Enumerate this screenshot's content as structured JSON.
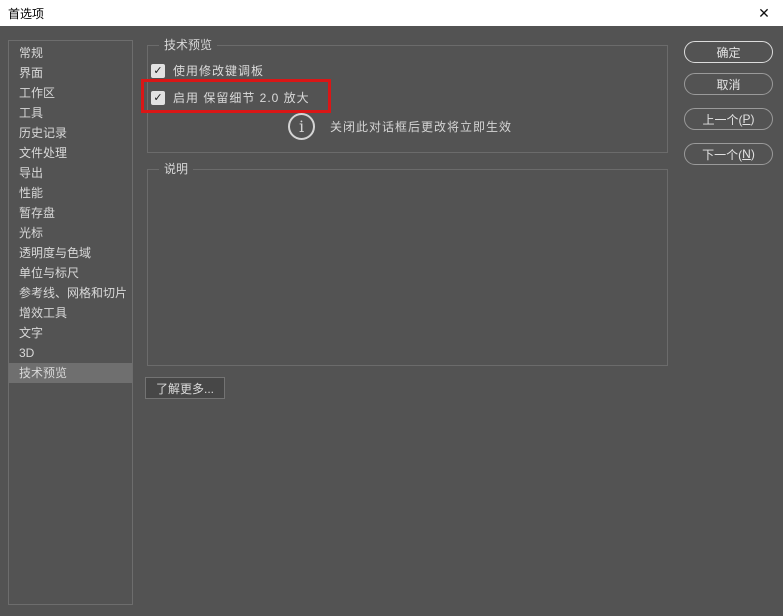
{
  "window": {
    "title": "首选项",
    "close_glyph": "✕"
  },
  "sidebar": {
    "items": [
      {
        "label": "常规",
        "selected": false
      },
      {
        "label": "界面",
        "selected": false
      },
      {
        "label": "工作区",
        "selected": false
      },
      {
        "label": "工具",
        "selected": false
      },
      {
        "label": "历史记录",
        "selected": false
      },
      {
        "label": "文件处理",
        "selected": false
      },
      {
        "label": "导出",
        "selected": false
      },
      {
        "label": "性能",
        "selected": false
      },
      {
        "label": "暂存盘",
        "selected": false
      },
      {
        "label": "光标",
        "selected": false
      },
      {
        "label": "透明度与色域",
        "selected": false
      },
      {
        "label": "单位与标尺",
        "selected": false
      },
      {
        "label": "参考线、网格和切片",
        "selected": false
      },
      {
        "label": "增效工具",
        "selected": false
      },
      {
        "label": "文字",
        "selected": false
      },
      {
        "label": "3D",
        "selected": false
      },
      {
        "label": "技术预览",
        "selected": true
      }
    ]
  },
  "content": {
    "tech_group": {
      "title": "技术预览",
      "check_glyph": "✓",
      "checkbox_modifier": {
        "label": "使用修改键调板",
        "checked": true
      },
      "checkbox_preserve": {
        "label": "启用 保留细节 2.0 放大",
        "checked": true,
        "annotated": true
      },
      "info_glyph": "i",
      "info_text": "关闭此对话框后更改将立即生效"
    },
    "desc_group": {
      "title": "说明",
      "content": ""
    },
    "learn_more_label": "了解更多..."
  },
  "actions": {
    "ok": "确定",
    "cancel": "取消",
    "prev": {
      "pre": "上一个(",
      "key": "P",
      "post": ")"
    },
    "next": {
      "pre": "下一个(",
      "key": "N",
      "post": ")"
    }
  },
  "annotation": {
    "highlight_color": "#da1616"
  },
  "colors": {
    "dialog_bg": "#535353",
    "titlebar_bg": "#ffffff",
    "text": "#d8d8d8",
    "border": "#6b6b6b",
    "selected_item_bg": "#6f6f6f",
    "checkbox_bg": "#e2e2e2"
  }
}
